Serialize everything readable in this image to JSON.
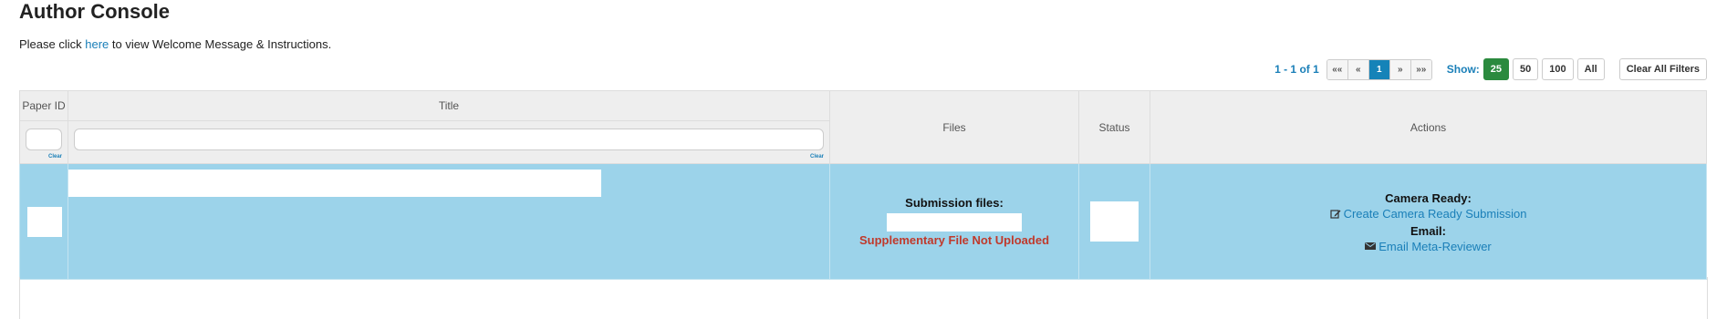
{
  "page": {
    "title": "Author Console",
    "intro_before": "Please click ",
    "intro_link": "here",
    "intro_after": " to view Welcome Message & Instructions."
  },
  "pager": {
    "count": "1 - 1 of 1",
    "first": "««",
    "prev": "«",
    "current": "1",
    "next": "»",
    "last": "»»",
    "show_label": "Show:",
    "sizes": [
      "25",
      "50",
      "100",
      "All"
    ],
    "clear_all": "Clear All Filters"
  },
  "table": {
    "headers": {
      "paper_id": "Paper ID",
      "title": "Title",
      "files": "Files",
      "status": "Status",
      "actions": "Actions"
    },
    "clear_label": "Clear",
    "row": {
      "files_label": "Submission files:",
      "supplementary": "Supplementary File Not Uploaded",
      "camera_ready_label": "Camera Ready:",
      "camera_ready_link": "Create Camera Ready Submission",
      "email_label": "Email:",
      "email_link": "Email Meta-Reviewer"
    }
  },
  "colors": {
    "row_bg": "#9cd3ea",
    "link": "#1a7fb8",
    "active_page": "#1583b8",
    "active_size": "#2b8a3e",
    "error": "#c0392b"
  },
  "icons": {
    "camera_ready": "edit-icon",
    "email": "envelope-icon"
  }
}
